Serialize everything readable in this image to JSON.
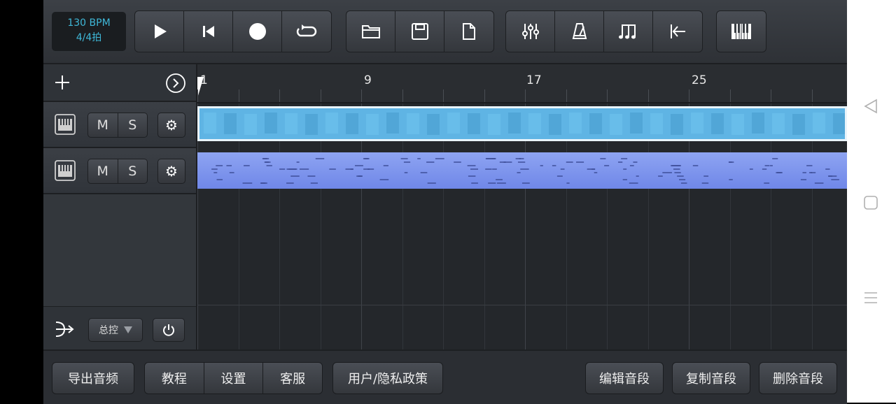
{
  "toolbar": {
    "tempo_bpm": "130 BPM",
    "time_signature": "4/4拍",
    "transport": [
      "play-icon",
      "skip-to-start-icon",
      "record-icon",
      "loop-icon"
    ],
    "file": [
      "open-folder-icon",
      "save-icon",
      "new-file-icon"
    ],
    "tools": [
      "mixer-icon",
      "metronome-icon",
      "music-note-icon",
      "snap-to-start-icon"
    ],
    "keyboard": [
      "piano-keyboard-icon"
    ]
  },
  "ruler": {
    "bars": [
      "1",
      "9",
      "17",
      "25"
    ]
  },
  "tracks": [
    {
      "mute_label": "M",
      "solo_label": "S",
      "clip_color": "#5fb4e4"
    },
    {
      "mute_label": "M",
      "solo_label": "S",
      "clip_color": "#7f94ec"
    }
  ],
  "master": {
    "mix_label": "总控"
  },
  "bottom": {
    "export": "导出音频",
    "tutorial": "教程",
    "settings": "设置",
    "support": "客服",
    "privacy": "用户/隐私政策",
    "edit_clip": "编辑音段",
    "copy_clip": "复制音段",
    "delete_clip": "删除音段"
  }
}
